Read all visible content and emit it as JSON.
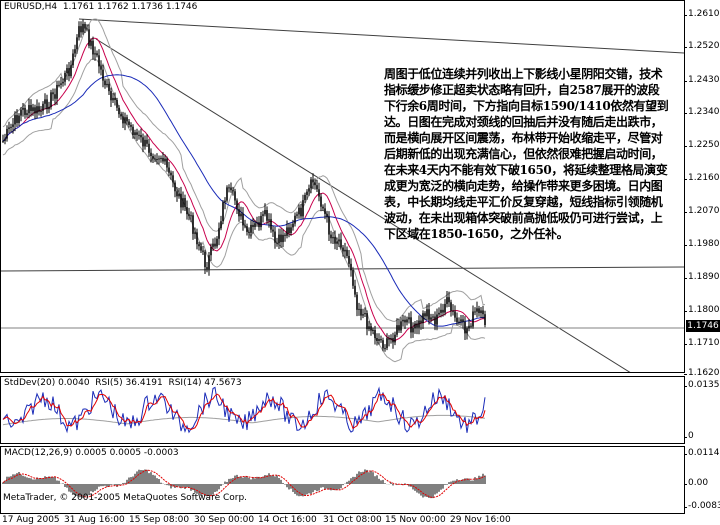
{
  "main_chart": {
    "header": "EURUSD,H4  1.1761 1.1762 1.1736 1.1746",
    "price_ticks": [
      "1.2610",
      "1.2520",
      "1.2430",
      "1.2340",
      "1.2250",
      "1.2160",
      "1.2070",
      "1.1980",
      "1.1890",
      "1.1800",
      "1.1710",
      "1.1620"
    ],
    "current_price": "1.1746",
    "comment": "周图于低位连续并列收出上下影线小星阴阳交错，技术指标缓步修正超卖状态略有回升，自2587展开的波段下行余6周时间，下方指向目标1590/1410依然有望到达。日图在完成对颈线的回抽后并没有随后走出跌市，而是横向展开区间震荡，布林带开始收缩走平，尽管对后期新低的出现充满信心，但依然很难把握启动时间，在未来4天内不能有效下破1650，将延续整理格局演变成更为宽泛的横向走势，给操作带来更多困境。日内图表，中长期均线走平汇价反复穿越，短线指标引领随机波动，在未出现箱体突破前高抛低吸仍可进行尝试，上下区域在1850-1650，之外任补。",
    "colors": {
      "candles": "#000000",
      "bollinger": "#a0a0a0",
      "ma_fast": "#c8004c",
      "ma_slow": "#1a2bb8",
      "trendline": "#404040"
    }
  },
  "oscillator": {
    "label": "StdDev(20) 0.0040  RSI(5) 36.4191  RSI(14) 47.5673",
    "ticks": [
      "0.0135",
      "0"
    ],
    "colors": {
      "stddev": "#a0a0a0",
      "rsi5": "#1a2bb8",
      "rsi14": "#e00000"
    }
  },
  "macd": {
    "label": "MACD(12,26,9) 0.0005 0.0005 -0.0003",
    "ticks": [
      "0.0114",
      "0.00",
      "-0.0083"
    ],
    "colors": {
      "histogram": "#808080",
      "macd": "#000000",
      "signal": "#e00000"
    }
  },
  "copyright": "MetaTrader, © 2001-2005 MetaQuotes Software Corp.",
  "time_axis": [
    "17 Aug 2005",
    "31 Aug 16:00",
    "15 Sep 08:00",
    "30 Sep 00:00",
    "14 Oct 16:00",
    "31 Oct 08:00",
    "15 Nov 00:00",
    "29 Nov 16:00"
  ]
}
